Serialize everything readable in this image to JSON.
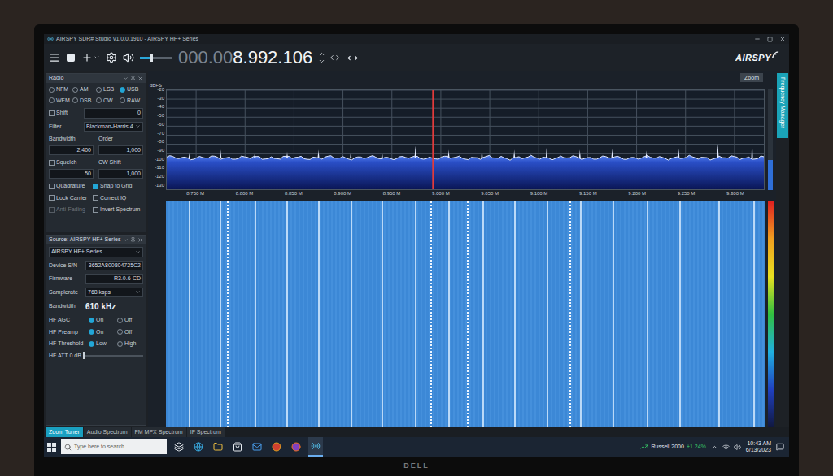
{
  "photo": {
    "monitor_brand": "DELL"
  },
  "window": {
    "title": "AIRSPY SDR# Studio v1.0.0.1910 - AIRSPY HF+ Series"
  },
  "toolbar": {
    "volume_level": 0.35,
    "frequency_dim": "000.00",
    "frequency": "8.992.106",
    "logo": "AIRSPY"
  },
  "zoom_button": "Zoom",
  "side_tab": "Frequency Manager",
  "radio_panel": {
    "title": "Radio",
    "modes": [
      {
        "label": "NFM",
        "selected": false
      },
      {
        "label": "AM",
        "selected": false
      },
      {
        "label": "LSB",
        "selected": false
      },
      {
        "label": "USB",
        "selected": true
      },
      {
        "label": "WFM",
        "selected": false
      },
      {
        "label": "DSB",
        "selected": false
      },
      {
        "label": "CW",
        "selected": false
      },
      {
        "label": "RAW",
        "selected": false
      }
    ],
    "shift": {
      "label": "Shift",
      "checked": false,
      "value": "0"
    },
    "filter": {
      "label": "Filter",
      "value": "Blackman-Harris 4"
    },
    "bandwidth": {
      "label": "Bandwidth",
      "value": "2,400"
    },
    "order": {
      "label": "Order",
      "value": "1,000"
    },
    "squelch": {
      "label": "Squelch",
      "checked": false,
      "value": "50"
    },
    "cw_shift": {
      "label": "CW Shift",
      "value": "1,000"
    },
    "options": [
      {
        "label": "Quadrature",
        "checked": false,
        "disabled": false
      },
      {
        "label": "Snap to Grid",
        "checked": true,
        "disabled": false
      },
      {
        "label": "Lock Carrier",
        "checked": false,
        "disabled": false
      },
      {
        "label": "Correct IQ",
        "checked": false,
        "disabled": false
      },
      {
        "label": "Anti-Fading",
        "checked": false,
        "disabled": true
      },
      {
        "label": "Invert Spectrum",
        "checked": false,
        "disabled": false
      }
    ]
  },
  "source_panel": {
    "title": "Source: AIRSPY HF+ Series",
    "device": "AIRSPY HF+ Series",
    "fields": [
      {
        "label": "Device S/N",
        "value": "3652A800804725C2"
      },
      {
        "label": "Firmware",
        "value": "R3.0.6-CD"
      },
      {
        "label": "Samplerate",
        "value": "768 ksps"
      }
    ],
    "bandwidth": {
      "label": "Bandwidth",
      "value": "610 kHz"
    },
    "toggles": [
      {
        "label": "HF AGC",
        "options": [
          {
            "label": "On",
            "selected": true
          },
          {
            "label": "Off",
            "selected": false
          }
        ]
      },
      {
        "label": "HF Preamp",
        "options": [
          {
            "label": "On",
            "selected": true
          },
          {
            "label": "Off",
            "selected": false
          }
        ]
      },
      {
        "label": "HF Threshold",
        "options": [
          {
            "label": "Low",
            "selected": true
          },
          {
            "label": "High",
            "selected": false
          }
        ]
      }
    ],
    "attenuator": {
      "label": "HF ATT 0 dB",
      "level": 0
    }
  },
  "spectrum": {
    "unit": "dBFS",
    "y_ticks": [
      "-20",
      "-30",
      "-40",
      "-50",
      "-60",
      "-70",
      "-80",
      "-90",
      "-100",
      "-110",
      "-120",
      "-130"
    ],
    "x_ticks": [
      {
        "label": "8.750 M",
        "mhz": 8.75
      },
      {
        "label": "8.800 M",
        "mhz": 8.8
      },
      {
        "label": "8.850 M",
        "mhz": 8.85
      },
      {
        "label": "8.900 M",
        "mhz": 8.9
      },
      {
        "label": "8.950 M",
        "mhz": 8.95
      },
      {
        "label": "9.000 M",
        "mhz": 9.0
      },
      {
        "label": "9.050 M",
        "mhz": 9.05
      },
      {
        "label": "9.100 M",
        "mhz": 9.1
      },
      {
        "label": "9.150 M",
        "mhz": 9.15
      },
      {
        "label": "9.200 M",
        "mhz": 9.2
      },
      {
        "label": "9.250 M",
        "mhz": 9.25
      },
      {
        "label": "9.300 M",
        "mhz": 9.3
      }
    ],
    "start_mhz": 8.72,
    "end_mhz": 9.33,
    "noise_floor_dbfs": -95,
    "tuned_mhz": 8.992106,
    "level_bar": 0.3,
    "carriers": [
      {
        "mhz": 8.743,
        "dbfs": -89
      },
      {
        "mhz": 8.775,
        "dbfs": -86
      },
      {
        "mhz": 8.81,
        "dbfs": -87
      },
      {
        "mhz": 8.843,
        "dbfs": -88
      },
      {
        "mhz": 8.875,
        "dbfs": -86
      },
      {
        "mhz": 8.908,
        "dbfs": -87
      },
      {
        "mhz": 8.94,
        "dbfs": -87
      },
      {
        "mhz": 8.974,
        "dbfs": -82
      },
      {
        "mhz": 9.008,
        "dbfs": -86
      },
      {
        "mhz": 9.042,
        "dbfs": -85
      },
      {
        "mhz": 9.075,
        "dbfs": -86
      },
      {
        "mhz": 9.108,
        "dbfs": -84
      },
      {
        "mhz": 9.142,
        "dbfs": -86
      },
      {
        "mhz": 9.175,
        "dbfs": -85
      },
      {
        "mhz": 9.21,
        "dbfs": -87
      },
      {
        "mhz": 9.243,
        "dbfs": -85
      },
      {
        "mhz": 9.283,
        "dbfs": -80
      },
      {
        "mhz": 9.318,
        "dbfs": -79
      }
    ]
  },
  "waterfall": {
    "bursts_mhz": [
      8.782,
      8.989,
      9.027,
      9.131
    ]
  },
  "bottom_tabs": [
    {
      "label": "Zoom Tuner",
      "selected": true
    },
    {
      "label": "Audio Spectrum",
      "selected": false
    },
    {
      "label": "FM MPX Spectrum",
      "selected": false
    },
    {
      "label": "IF Spectrum",
      "selected": false
    }
  ],
  "taskbar": {
    "search_placeholder": "Type here to search",
    "ticker": {
      "name": "Russell 2000",
      "change": "+1.24%"
    },
    "time": "10:43 AM",
    "date": "6/13/2023"
  }
}
